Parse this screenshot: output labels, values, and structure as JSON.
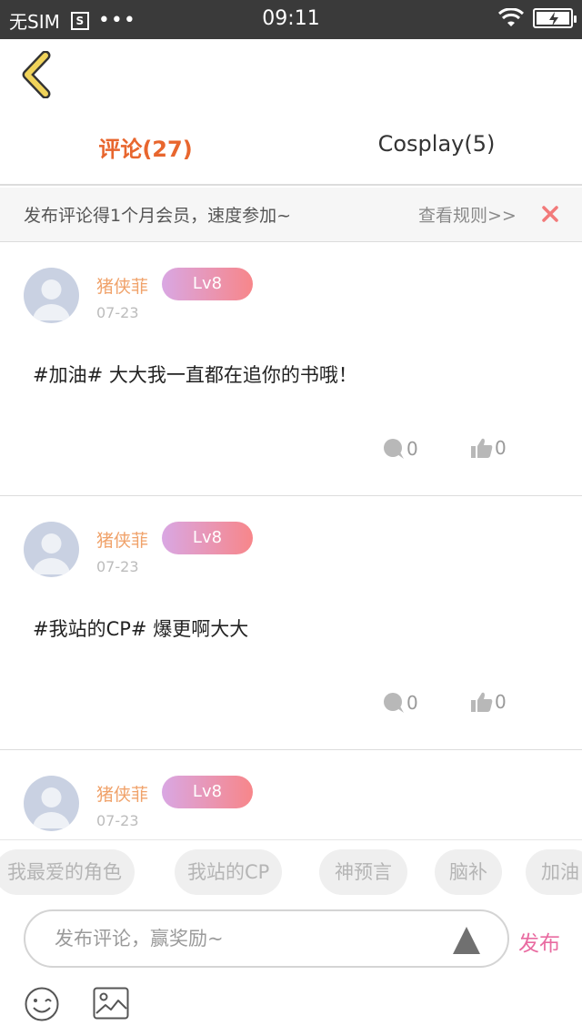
{
  "status_bar": {
    "carrier": "无SIM",
    "sim_icon": "S",
    "more_icon": "•••",
    "time": "09:11"
  },
  "tabs": [
    {
      "label": "评论(27)",
      "active": true
    },
    {
      "label": "Cosplay(5)",
      "active": false
    }
  ],
  "notice": {
    "text": "发布评论得1个月会员，速度参加~",
    "link": "查看规则>>",
    "close_icon": "close-icon"
  },
  "comments": [
    {
      "user": "猪侠菲",
      "level": "Lv8",
      "date": "07-23",
      "content": "#加油# 大大我一直都在追你的书哦！",
      "replies": "0",
      "likes": "0"
    },
    {
      "user": "猪侠菲",
      "level": "Lv8",
      "date": "07-23",
      "content": "#我站的CP# 爆更啊大大",
      "replies": "0",
      "likes": "0"
    },
    {
      "user": "猪侠菲",
      "level": "Lv8",
      "date": "07-23",
      "content": "",
      "replies": "",
      "likes": ""
    }
  ],
  "tags": [
    "我最爱的角色",
    "我站的CP",
    "神预言",
    "脑补",
    "加油"
  ],
  "composer": {
    "placeholder": "发布评论，赢奖励~",
    "publish_label": "发布"
  },
  "colors": {
    "accent": "#e8662e",
    "username": "#f0a26a",
    "publish": "#e96ba1",
    "back_arrow": "#f0d35a"
  }
}
